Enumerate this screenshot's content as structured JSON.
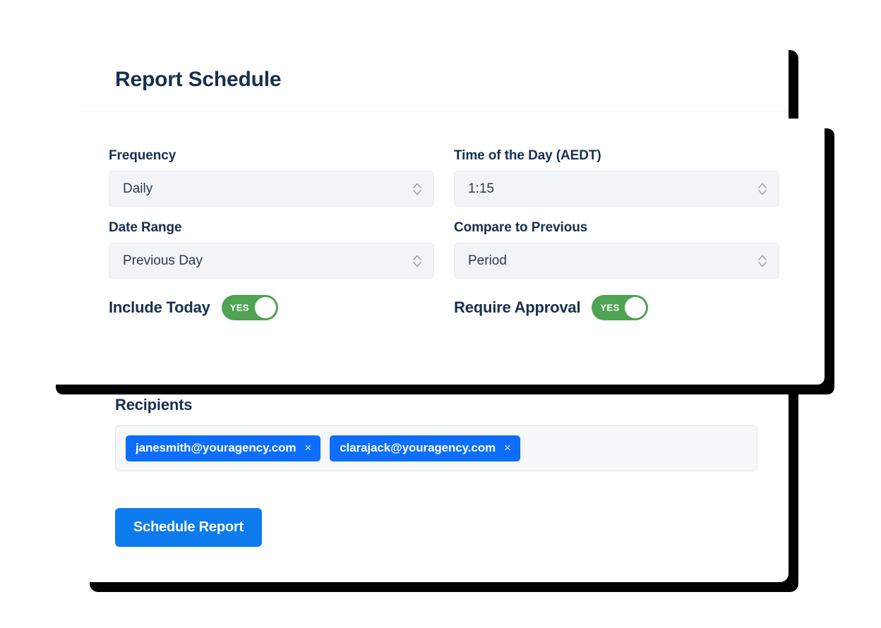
{
  "card": {
    "title": "Report Schedule"
  },
  "form": {
    "rows": [
      {
        "left": {
          "label": "Frequency",
          "value": "Daily",
          "icon": "chevron-updown-icon"
        },
        "right": {
          "label": "Time of the Day (AEDT)",
          "value": "1:15",
          "icon": "chevron-updown-icon"
        }
      },
      {
        "left": {
          "label": "Date Range",
          "value": "Previous Day",
          "icon": "chevron-updown-icon"
        },
        "right": {
          "label": "Compare to Previous",
          "value": "Period",
          "icon": "chevron-updown-icon"
        }
      }
    ],
    "toggles": [
      {
        "label": "Include Today",
        "state_text": "YES",
        "on": true
      },
      {
        "label": "Require Approval",
        "state_text": "YES",
        "on": true
      }
    ]
  },
  "recipients": {
    "label": "Recipients",
    "chips": [
      {
        "email": "janesmith@youragency.com",
        "remove_icon": "close-icon",
        "remove_glyph": "×"
      },
      {
        "email": "clarajack@youragency.com",
        "remove_icon": "close-icon",
        "remove_glyph": "×"
      }
    ]
  },
  "actions": {
    "submit_label": "Schedule Report"
  },
  "colors": {
    "heading": "#16304f",
    "accent_blue": "#0d7aee",
    "chip_blue": "#0d6efd",
    "toggle_green": "#4fa352",
    "field_bg": "#f2f4f7",
    "shadow": "#000000"
  }
}
